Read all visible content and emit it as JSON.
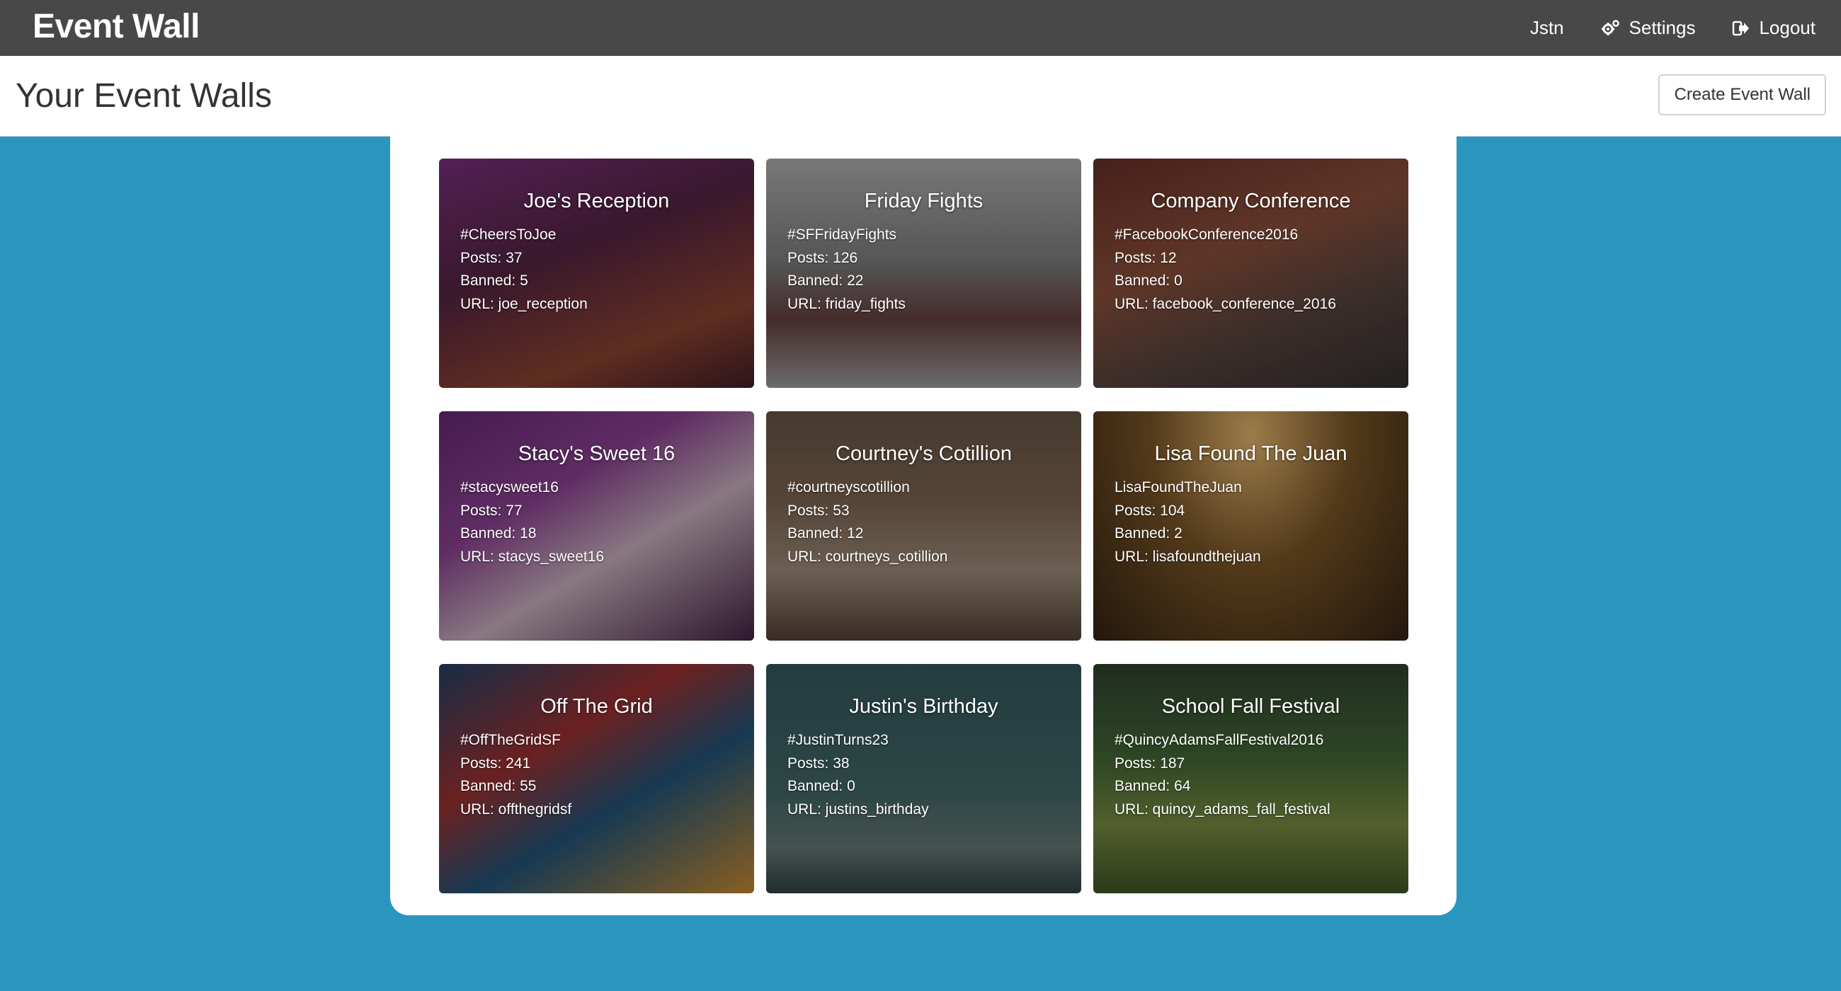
{
  "navbar": {
    "brand": "Event Wall",
    "user": "Jstn",
    "settings_label": "Settings",
    "logout_label": "Logout"
  },
  "header": {
    "title": "Your Event Walls",
    "create_button": "Create Event Wall"
  },
  "colors": {
    "navbar_bg": "#484848",
    "page_bg": "#2a96bf",
    "panel_bg": "#ffffff"
  },
  "walls": [
    {
      "title": "Joe's Reception",
      "hashtag": "#CheersToJoe",
      "posts": "Posts: 37",
      "banned": "Banned: 5",
      "url": "URL: joe_reception",
      "theme": "linear-gradient(160deg, #6a2a6e 0%, #4a1f3a 40%, #7a3b2a 75%, #3a1a22 100%)"
    },
    {
      "title": "Friday Fights",
      "hashtag": "#SFFridayFights",
      "posts": "Posts: 126",
      "banned": "Banned: 22",
      "url": "URL: friday_fights",
      "theme": "linear-gradient(180deg, #9a9a9a 0%, #6e6e6e 45%, #5a3838 70%, #8a8a8a 100%)"
    },
    {
      "title": "Company Conference",
      "hashtag": "#FacebookConference2016",
      "posts": "Posts: 12",
      "banned": "Banned: 0",
      "url": "URL: facebook_conference_2016",
      "theme": "linear-gradient(160deg, #5a2a22 0%, #7a4634 40%, #4a3a36 70%, #2e2a2a 100%)"
    },
    {
      "title": "Stacy's Sweet 16",
      "hashtag": "#stacysweet16",
      "posts": "Posts: 77",
      "banned": "Banned: 18",
      "url": "URL: stacys_sweet16",
      "theme": "linear-gradient(150deg, #5a2466 0%, #7a3a80 35%, #b09aa6 60%, #3a1e3a 100%)"
    },
    {
      "title": "Courtney's Cotillion",
      "hashtag": "#courtneyscotillion",
      "posts": "Posts: 53",
      "banned": "Banned: 12",
      "url": "URL: courtneys_cotillion",
      "theme": "linear-gradient(180deg, #5a4a3c 0%, #6e5a48 40%, #8a7a6a 70%, #4a3a30 100%)"
    },
    {
      "title": "Lisa Found The Juan",
      "hashtag": "LisaFoundTheJuan",
      "posts": "Posts: 104",
      "banned": "Banned: 2",
      "url": "URL: lisafoundthejuan",
      "theme": "radial-gradient(ellipse at 50% 10%, #c8a060 0%, #6a4a22 45%, #2e1e10 100%)"
    },
    {
      "title": "Off The Grid",
      "hashtag": "#OffTheGridSF",
      "posts": "Posts: 241",
      "banned": "Banned: 55",
      "url": "URL: offthegridsf",
      "theme": "linear-gradient(150deg, #1e3a5a 0%, #8a2a2a 35%, #1e4a6a 60%, #b07a2a 100%)"
    },
    {
      "title": "Justin's Birthday",
      "hashtag": "#JustinTurns23",
      "posts": "Posts: 38",
      "banned": "Banned: 0",
      "url": "URL: justins_birthday",
      "theme": "linear-gradient(180deg, #2e4e52 0%, #3a5a5a 55%, #5a6a66 80%, #2a3a3c 100%)"
    },
    {
      "title": "School Fall Festival",
      "hashtag": "#QuincyAdamsFallFestival2016",
      "posts": "Posts: 187",
      "banned": "Banned: 64",
      "url": "URL: quincy_adams_fall_festival",
      "theme": "linear-gradient(180deg, #2a3a2a 0%, #3a5a2e 40%, #6a7a3a 70%, #3a4a22 100%)"
    }
  ]
}
